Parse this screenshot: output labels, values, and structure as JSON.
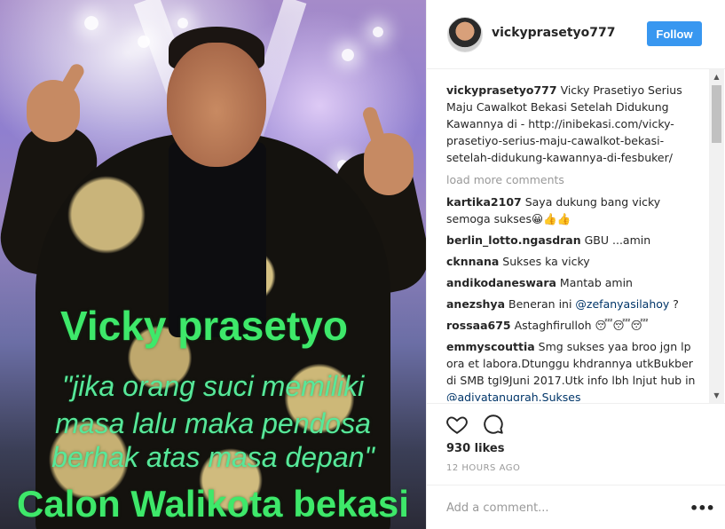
{
  "post": {
    "username": "vickyprasetyo777",
    "follow_label": "Follow",
    "image_overlay": {
      "name": "Vicky prasetyo",
      "quote_line1": "\"jika orang suci memiliki",
      "quote_line2": "masa lalu maka pendosa",
      "quote_line3": "berhak atas masa depan\"",
      "title": "Calon Walikota bekasi"
    },
    "caption": {
      "user": "vickyprasetyo777",
      "text": "Vicky Prasetiyo Serius Maju Cawalkot Bekasi Setelah Didukung Kawannya di - http://inibekasi.com/vicky-prasetiyo-serius-maju-cawalkot-bekasi-setelah-didukung-kawannya-di-fesbuker/"
    },
    "load_more": "load more comments",
    "comments": [
      {
        "user": "kartika2107",
        "text": "Saya dukung bang vicky semoga sukses😀👍👍"
      },
      {
        "user": "berlin_lotto.ngasdran",
        "text": "GBU ...amin"
      },
      {
        "user": "cknnana",
        "text": "Sukses ka vicky"
      },
      {
        "user": "andikodaneswara",
        "text": "Mantab amin"
      },
      {
        "user": "anezshya",
        "text": "Beneran ini ",
        "mention": "@zefanyasilahoy",
        "after": " ?"
      },
      {
        "user": "rossaa675",
        "text": "Astaghfirulloh 😴😴😴"
      },
      {
        "user": "emmyscouttia",
        "text": "Smg sukses yaa broo jgn lp ora et labora.Dtunggu khdrannya utkBukber di SMB tgl9Juni 2017.Utk info lbh lnjut hub in ",
        "mention": "@adiyatanugrah.Sukses",
        "after": ""
      }
    ],
    "likes": "930 likes",
    "timestamp": "12 HOURS AGO",
    "add_comment_placeholder": "Add a comment...",
    "more_label": "•••"
  },
  "colors": {
    "follow_bg": "#3897f0",
    "overlay_green": "#3ee86a",
    "link": "#003569"
  }
}
